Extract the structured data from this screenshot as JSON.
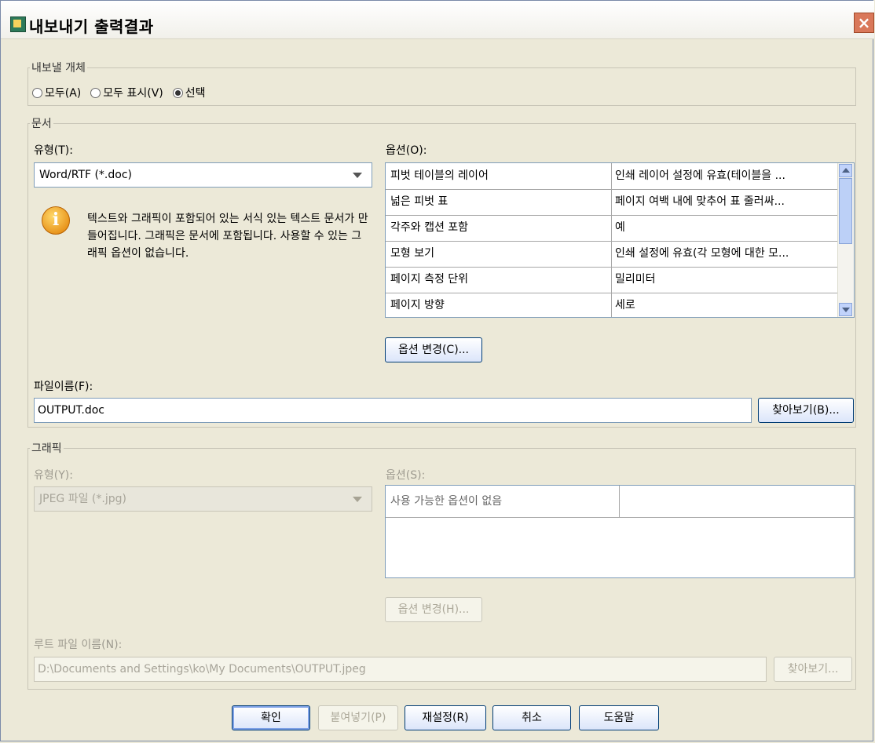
{
  "window": {
    "title": "내보내기 출력결과",
    "close_label": "×"
  },
  "export_objects": {
    "legend": "내보낼 개체",
    "options": [
      {
        "label": "모두(A)",
        "checked": false
      },
      {
        "label": "모두 표시(V)",
        "checked": false
      },
      {
        "label": "선택",
        "checked": true
      }
    ]
  },
  "document": {
    "legend": "문서",
    "type_label": "유형(T):",
    "type_value": "Word/RTF (*.doc)",
    "info_icon": "info-icon",
    "info_text": "텍스트와 그래픽이 포함되어 있는 서식 있는 텍스트 문서가 만들어집니다. 그래픽은 문서에 포함됩니다. 사용할 수 있는 그래픽 옵션이 없습니다.",
    "options_label": "옵션(O):",
    "options_rows": [
      {
        "name": "피벗 테이블의 레이어",
        "value": "인쇄 레이어 설정에 유효(테이블을 ..."
      },
      {
        "name": "넓은 피벗 표",
        "value": "페이지 여백 내에 맞추어 표 줄러싸..."
      },
      {
        "name": "각주와 캡션 포함",
        "value": "예"
      },
      {
        "name": "모형 보기",
        "value": "인쇄 설정에 유효(각 모형에 대한 모..."
      },
      {
        "name": "페이지 측정 단위",
        "value": "밀리미터"
      },
      {
        "name": "페이지 방향",
        "value": "세로"
      }
    ],
    "change_options_button": "옵션 변경(C)...",
    "filename_label": "파일이름(F):",
    "filename_value": "OUTPUT.doc",
    "browse_button": "찾아보기(B)..."
  },
  "graphics": {
    "legend": "그래픽",
    "type_label": "유형(Y):",
    "type_value": "JPEG 파일 (*.jpg)",
    "options_label": "옵션(S):",
    "no_options_text": "사용 가능한 옵션이 없음",
    "change_options_button": "옵션 변경(H)...",
    "root_filename_label": "루트 파일 이름(N):",
    "root_filename_value": "D:\\Documents and Settings\\ko\\My Documents\\OUTPUT.jpeg",
    "browse_button": "찾아보기..."
  },
  "footer": {
    "ok": "확인",
    "paste": "붙여넣기(P)",
    "reset": "재설정(R)",
    "cancel": "취소",
    "help": "도움말"
  }
}
